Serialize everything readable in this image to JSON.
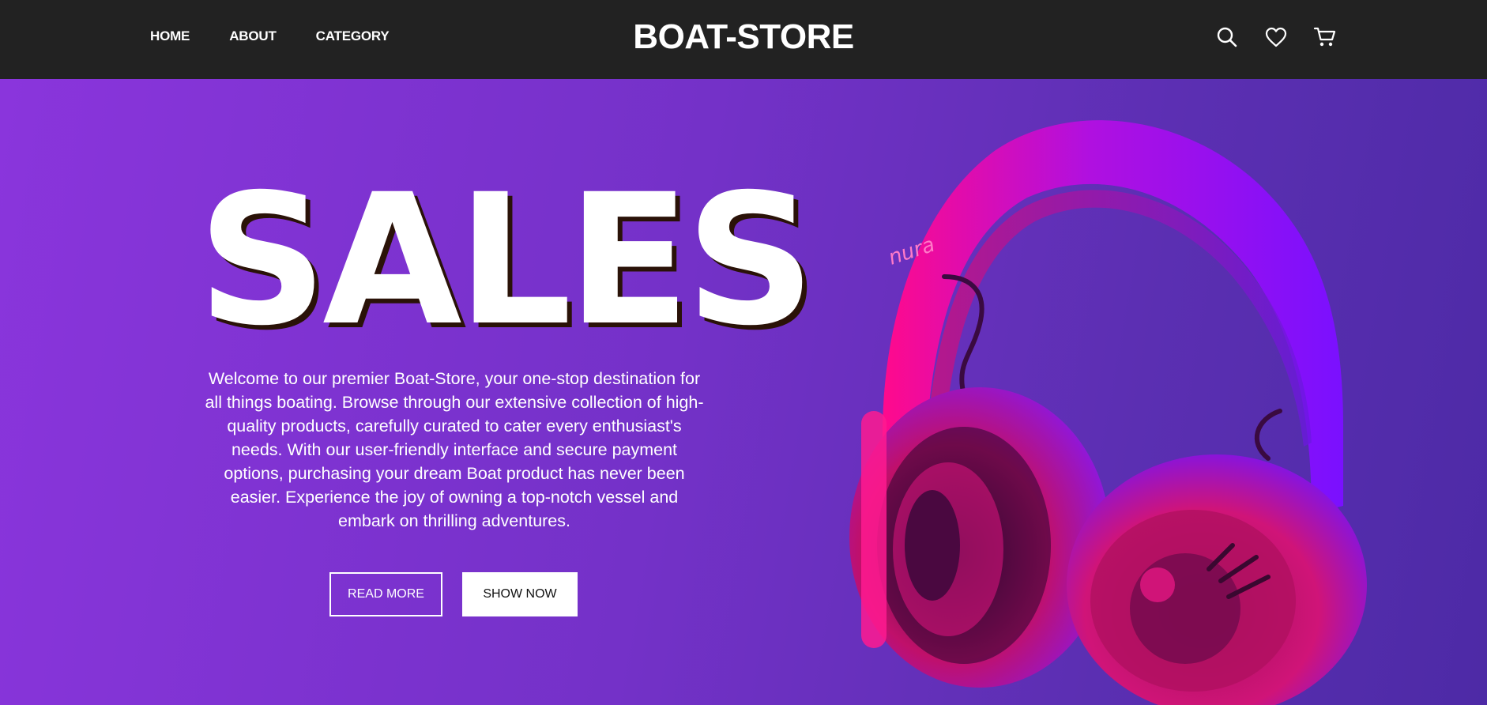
{
  "header": {
    "nav": [
      "HOME",
      "ABOUT",
      "CATEGORY"
    ],
    "brand": "BOAT-STORE",
    "icons": [
      "search-icon",
      "heart-icon",
      "cart-icon"
    ]
  },
  "hero": {
    "headline": "SALES",
    "description": "Welcome to our premier Boat-Store, your one-stop destination for all things boating. Browse through our extensive collection of high-quality products, carefully curated to cater every enthusiast's needs. With our user-friendly interface and secure payment options, purchasing your dream Boat product has never been easier. Experience the joy of owning a top-notch vessel and embark on thrilling adventures.",
    "read_more_label": "READ MORE",
    "show_now_label": "SHOW NOW",
    "product_logo_text": "nura"
  },
  "colors": {
    "header_bg": "#222222",
    "hero_gradient_start": "#8a35dc",
    "hero_gradient_end": "#4d2aa6",
    "headphone_pink": "#ff0a8c",
    "headphone_violet": "#8a14ff"
  }
}
